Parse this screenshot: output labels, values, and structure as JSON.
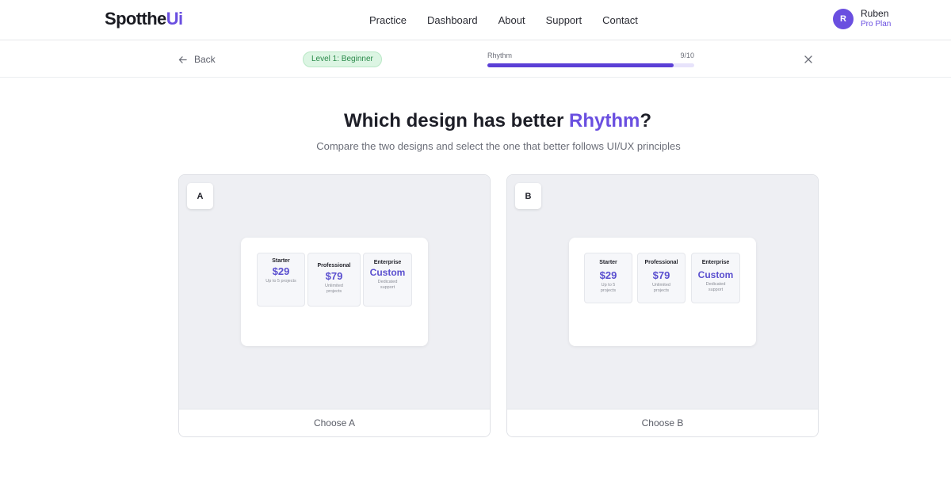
{
  "header": {
    "logo_main": "Spotthe",
    "logo_accent": "Ui",
    "nav": [
      "Practice",
      "Dashboard",
      "About",
      "Support",
      "Contact"
    ],
    "user": {
      "initial": "R",
      "name": "Ruben",
      "plan": "Pro Plan"
    }
  },
  "subbar": {
    "back_label": "Back",
    "level": "Level 1: Beginner",
    "progress_label": "Rhythm",
    "progress_count": "9/10",
    "progress_value": 0.9
  },
  "main": {
    "question_prefix": "Which design has better ",
    "question_accent": "Rhythm",
    "question_suffix": "?",
    "subtitle": "Compare the two designs and select the one that better follows UI/UX principles"
  },
  "options": [
    {
      "badge": "A",
      "choose_label": "Choose A",
      "tiers": [
        {
          "name": "Starter",
          "price": "$29",
          "desc": "Up to 5 projects"
        },
        {
          "name": "Professional",
          "price": "$79",
          "desc": "Unlimited projects"
        },
        {
          "name": "Enterprise",
          "price": "Custom",
          "desc": "Dedicated support"
        }
      ]
    },
    {
      "badge": "B",
      "choose_label": "Choose B",
      "tiers": [
        {
          "name": "Starter",
          "price": "$29",
          "desc": "Up to 5 projects"
        },
        {
          "name": "Professional",
          "price": "$79",
          "desc": "Unlimited projects"
        },
        {
          "name": "Enterprise",
          "price": "Custom",
          "desc": "Dedicated support"
        }
      ]
    }
  ],
  "colors": {
    "accent": "#6a4fe0",
    "progress": "#5b3fd6",
    "level_bg": "#dcf5e3",
    "level_text": "#2a8a4a",
    "preview_bg": "#eeeff3"
  }
}
